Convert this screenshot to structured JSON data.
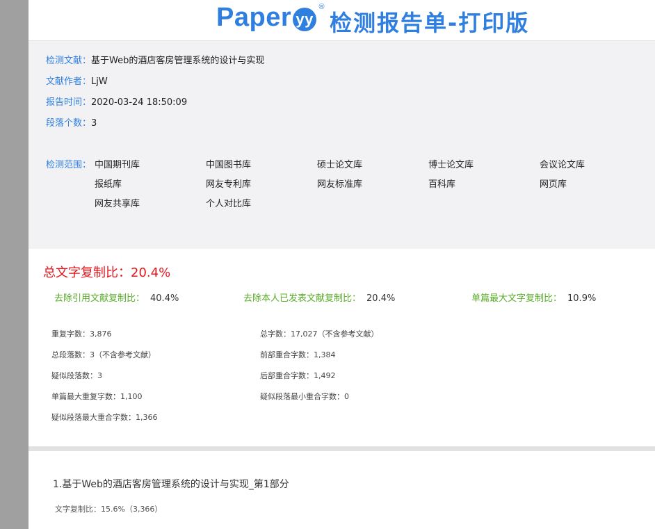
{
  "header": {
    "logo_text": "Paper",
    "logo_mark": "yy",
    "logo_reg": "®",
    "title": "检测报告单-打印版",
    "brand_color": "#2f7fe0"
  },
  "info": {
    "doc_label": "检测文献：",
    "doc_value": "基于Web的酒店客房管理系统的设计与实现",
    "author_label": "文献作者：",
    "author_value": "LjW",
    "time_label": "报告时间：",
    "time_value": "2020-03-24 18:50:09",
    "para_label": "段落个数：",
    "para_value": "3",
    "scope_label": "检测范围：",
    "scope_items": [
      "中国期刊库",
      "中国图书库",
      "硕士论文库",
      "博士论文库",
      "会议论文库",
      "报纸库",
      "网友专利库",
      "网友标准库",
      "百科库",
      "网页库",
      "网友共享库",
      "个人对比库"
    ]
  },
  "summary": {
    "total_label": "总文字复制比：",
    "total_value": "20.4%",
    "total_color": "#e0161b",
    "metrics": [
      {
        "label": "去除引用文献复制比：",
        "value": "40.4%"
      },
      {
        "label": "去除本人已发表文献复制比：",
        "value": "20.4%"
      },
      {
        "label": "单篇最大文字复制比：",
        "value": "10.9%"
      }
    ],
    "metric_color": "#5aac2a",
    "stats_left": [
      "重复字数：3,876",
      "总段落数：3（不含参考文献）",
      "疑似段落数：3",
      "单篇最大重复字数：1,100",
      "疑似段落最大重合字数：1,366"
    ],
    "stats_right": [
      "总字数：17,027（不含参考文献）",
      "前部重合字数：1,384",
      "后部重合字数：1,492",
      "疑似段落最小重合字数：0"
    ]
  },
  "part": {
    "title": "1.基于Web的酒店客房管理系统的设计与实现_第1部分",
    "ratio": "文字复制比：15.6%（3,366）"
  }
}
